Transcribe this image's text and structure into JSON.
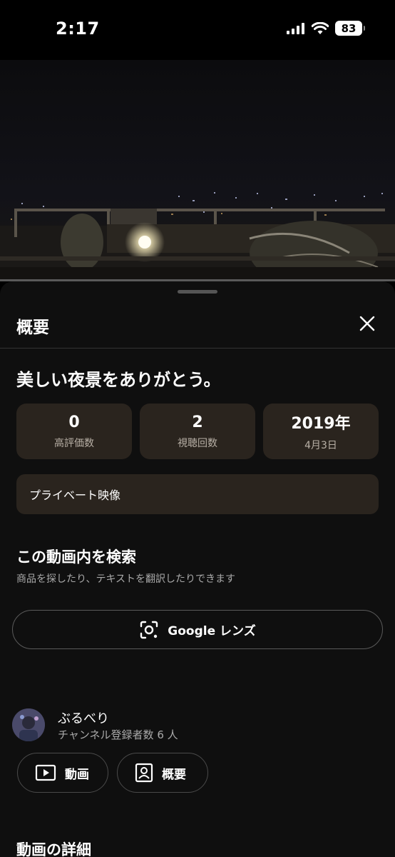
{
  "status_bar": {
    "time": "2:17",
    "battery": "83"
  },
  "sheet": {
    "title": "概要",
    "video_title": "美しい夜景をありがとう。",
    "stats": [
      {
        "value": "0",
        "label": "高評価数"
      },
      {
        "value": "2",
        "label": "視聴回数"
      },
      {
        "value": "2019年",
        "label": "4月3日"
      }
    ],
    "privacy_label": "プライベート映像",
    "search": {
      "title": "この動画内を検索",
      "subtitle": "商品を探したり、テキストを翻訳したりできます",
      "lens_button_label": "Google レンズ"
    },
    "channel": {
      "name": "ぶるべり",
      "subscribers": "チャンネル登録者数 6 人",
      "videos_button": "動画",
      "about_button": "概要"
    },
    "details_title": "動画の詳細"
  },
  "colors": {
    "background": "#0f0f0f",
    "stat_box": "#2a241e",
    "muted_text": "#aaaaaa"
  }
}
